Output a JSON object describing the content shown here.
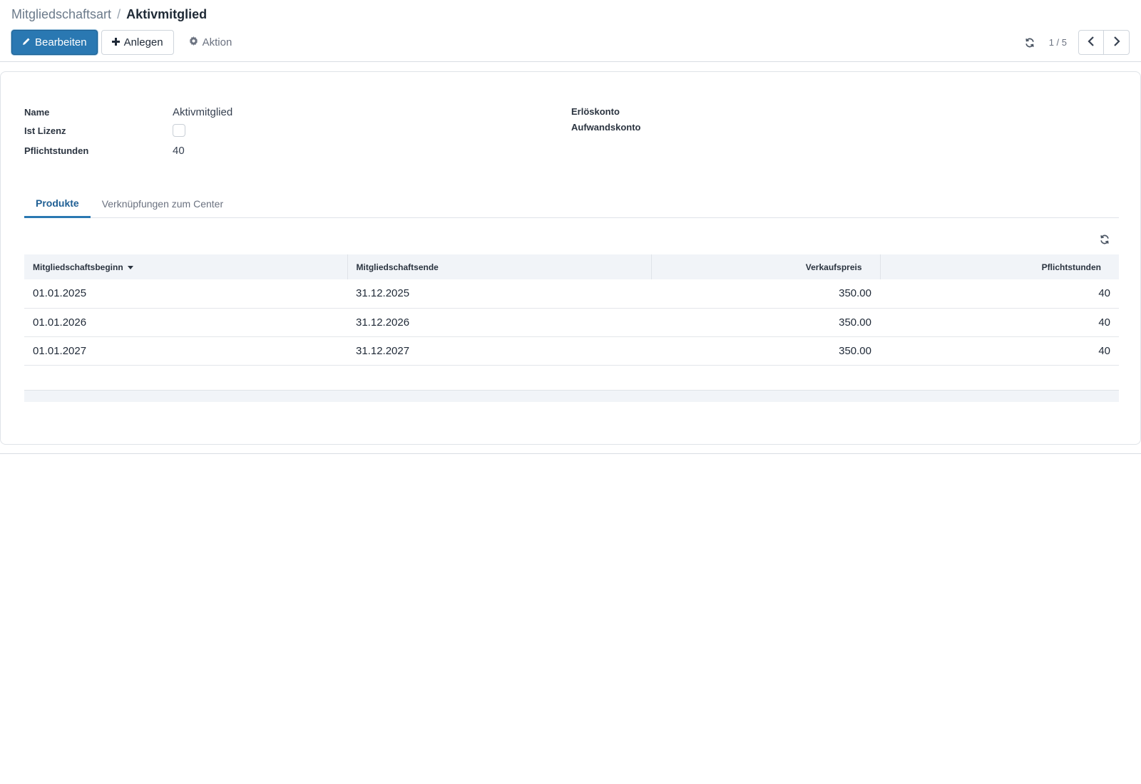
{
  "breadcrumb": {
    "parent": "Mitgliedschaftsart",
    "separator": "/",
    "current": "Aktivmitglied"
  },
  "toolbar": {
    "edit_label": "Bearbeiten",
    "create_label": "Anlegen",
    "action_label": "Aktion"
  },
  "pager": {
    "value": "1 / 5"
  },
  "form": {
    "name_label": "Name",
    "name_value": "Aktivmitglied",
    "license_label": "Ist Lizenz",
    "license_checked": false,
    "hours_label": "Pflichtstunden",
    "hours_value": "40",
    "revenue_account_label": "Erlöskonto",
    "expense_account_label": "Aufwandskonto"
  },
  "tabs": [
    {
      "label": "Produkte",
      "active": true
    },
    {
      "label": "Verknüpfungen zum Center",
      "active": false
    }
  ],
  "table": {
    "columns": [
      "Mitgliedschaftsbeginn",
      "Mitgliedschaftsende",
      "Verkaufspreis",
      "Pflichtstunden"
    ],
    "rows": [
      [
        "01.01.2025",
        "31.12.2025",
        "350.00",
        "40"
      ],
      [
        "01.01.2026",
        "31.12.2026",
        "350.00",
        "40"
      ],
      [
        "01.01.2027",
        "31.12.2027",
        "350.00",
        "40"
      ]
    ]
  },
  "colors": {
    "primary": "#2a78b2",
    "tab_active": "#1f5f94",
    "header_bg": "#f1f4f8"
  },
  "icons": {
    "edit": "pencil-icon",
    "create": "plus-icon",
    "action": "gear-icon",
    "refresh": "refresh-icon",
    "prev": "chevron-left-icon",
    "next": "chevron-right-icon",
    "sort": "caret-down-icon"
  }
}
